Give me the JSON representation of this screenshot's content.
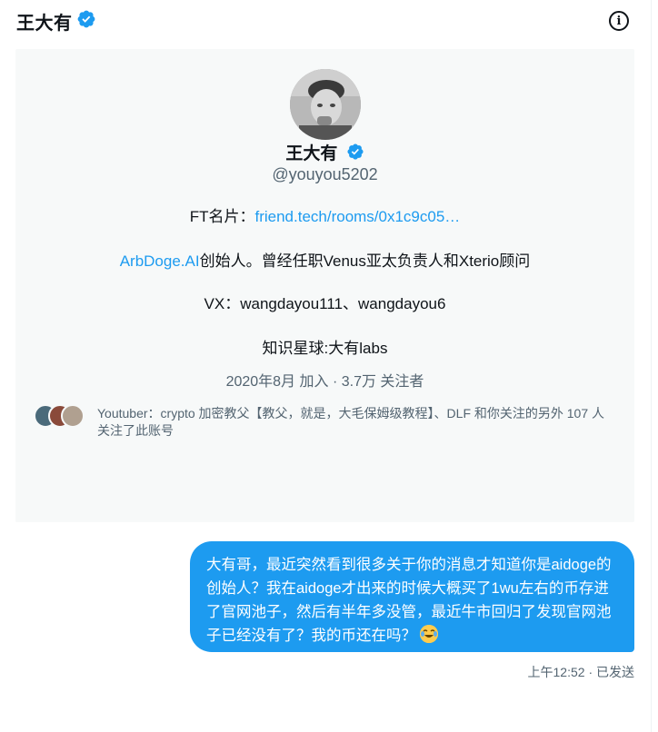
{
  "header": {
    "title": "王大有",
    "verified_color": "#1d9bf0",
    "info_icon": "info-icon"
  },
  "profile_card": {
    "name": "王大有",
    "handle": "@youyou5202",
    "bio": {
      "ft_prefix": "FT名片：",
      "ft_link": "friend.tech/rooms/0x1c9c05…",
      "line2_link": "ArbDoge.AI",
      "line2_rest": "创始人。曾经任职Venus亚太负责人和Xterio顾问",
      "line3": "VX：wangdayou111、wangdayou6",
      "line4": "知识星球:大有labs"
    },
    "meta": "2020年8月 加入 · 3.7万 关注者",
    "followed_by": "Youtuber：crypto 加密教父【教父，就是，大毛保姆级教程】、DLF 和你关注的另外 107 人关注了此账号"
  },
  "message": {
    "text": "大有哥，最近突然看到很多关于你的消息才知道你是aidoge的创始人？我在aidoge才出来的时候大概买了1wu左右的币存进了官网池子，然后有半年多没管，最近牛市回归了发现官网池子已经没有了？我的币还在吗？",
    "emoji": "face-with-tears-of-joy",
    "timestamp": "上午12:52 · 已发送",
    "bubble_color": "#1d9bf0"
  }
}
